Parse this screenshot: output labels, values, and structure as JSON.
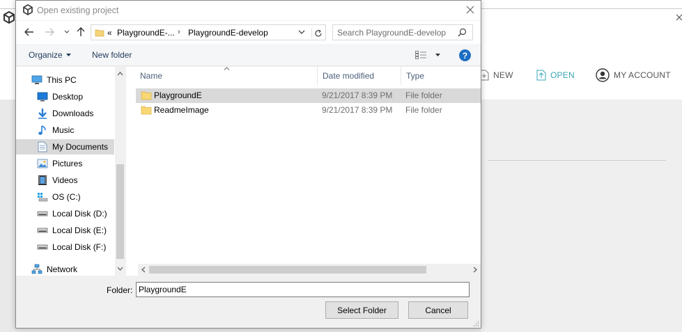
{
  "background_app": {
    "menu": {
      "new_label": "NEW",
      "open_label": "OPEN",
      "account_label": "MY ACCOUNT"
    },
    "accent_color": "#3aa6b8"
  },
  "dialog": {
    "title": "Open existing project",
    "breadcrumb": {
      "overflow": "«",
      "parent": "PlaygroundE-...",
      "current": "PlaygroundE-develop"
    },
    "search_placeholder": "Search PlaygroundE-develop",
    "toolbar": {
      "organize_label": "Organize",
      "new_folder_label": "New folder",
      "help_label": "?"
    },
    "nav_tree": [
      {
        "label": "This PC",
        "icon": "pc-icon"
      },
      {
        "label": "Desktop",
        "icon": "desktop-icon"
      },
      {
        "label": "Downloads",
        "icon": "downloads-icon"
      },
      {
        "label": "Music",
        "icon": "music-icon"
      },
      {
        "label": "My Documents",
        "icon": "documents-icon",
        "selected": true
      },
      {
        "label": "Pictures",
        "icon": "pictures-icon"
      },
      {
        "label": "Videos",
        "icon": "videos-icon"
      },
      {
        "label": "OS (C:)",
        "icon": "os-drive-icon"
      },
      {
        "label": "Local Disk (D:)",
        "icon": "disk-icon"
      },
      {
        "label": "Local Disk (E:)",
        "icon": "disk-icon"
      },
      {
        "label": "Local Disk (F:)",
        "icon": "disk-icon"
      },
      {
        "label": "Network",
        "icon": "network-icon"
      }
    ],
    "columns": {
      "name": "Name",
      "date": "Date modified",
      "type": "Type"
    },
    "files": [
      {
        "name": "PlaygroundE",
        "date": "9/21/2017 8:39 PM",
        "type": "File folder",
        "selected": true
      },
      {
        "name": "ReadmeImage",
        "date": "9/21/2017 8:39 PM",
        "type": "File folder",
        "selected": false
      }
    ],
    "folder_label": "Folder:",
    "folder_value": "PlaygroundE",
    "select_button": "Select Folder",
    "cancel_button": "Cancel"
  }
}
